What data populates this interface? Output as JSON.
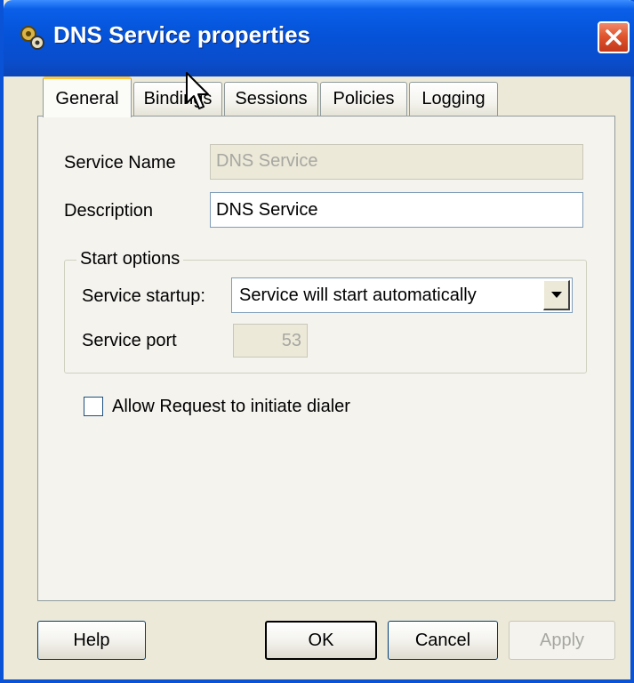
{
  "window": {
    "title": "DNS Service properties"
  },
  "tabs": [
    {
      "label": "General",
      "active": true
    },
    {
      "label": "Bindings",
      "active": false
    },
    {
      "label": "Sessions",
      "active": false
    },
    {
      "label": "Policies",
      "active": false
    },
    {
      "label": "Logging",
      "active": false
    }
  ],
  "general": {
    "service_name_label": "Service Name",
    "service_name_value": "DNS Service",
    "description_label": "Description",
    "description_value": "DNS Service",
    "start_options": {
      "legend": "Start options",
      "startup_label": "Service startup:",
      "startup_value": "Service will start automatically",
      "port_label": "Service port",
      "port_value": "53"
    },
    "dialer_checkbox_label": "Allow Request to initiate dialer",
    "dialer_checked": false
  },
  "buttons": {
    "help": "Help",
    "ok": "OK",
    "cancel": "Cancel",
    "apply": "Apply"
  },
  "colors": {
    "title_bar": "#0553d9",
    "dialog_bg": "#ece9d8",
    "close_button": "#e0552e",
    "active_tab_accent": "#ffc83c"
  },
  "icons": {
    "app": "service-gear-icon",
    "close": "close-icon",
    "dropdown": "chevron-down-icon",
    "cursor": "mouse-pointer-icon"
  }
}
